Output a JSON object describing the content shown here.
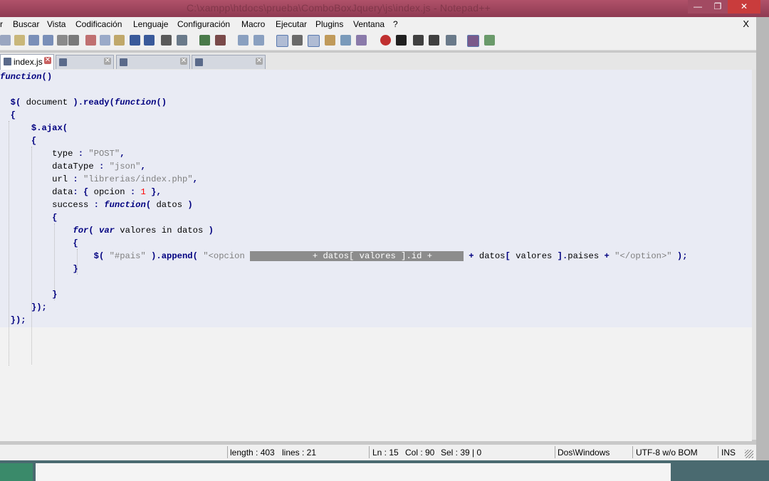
{
  "window": {
    "title": "C:\\xampp\\htdocs\\prueba\\ComboBoxJquery\\js\\index.js - Notepad++",
    "close_glyph": "✕"
  },
  "menu": {
    "items": [
      "r",
      "Buscar",
      "Vista",
      "Codificación",
      "Lenguaje",
      "Configuración",
      "Macro",
      "Ejecutar",
      "Plugins",
      "Ventana",
      "?"
    ],
    "close": "X"
  },
  "tabs": [
    {
      "label": "index.js",
      "active": true
    }
  ],
  "code": {
    "lines": [
      {
        "parts": [
          [
            "kw",
            "function"
          ],
          [
            "op",
            "()"
          ]
        ]
      },
      {
        "parts": []
      },
      {
        "parts": [
          [
            "op",
            "  $( "
          ],
          [
            "t",
            "document"
          ],
          [
            "op",
            " ).ready("
          ],
          [
            "kw",
            "function"
          ],
          [
            "op",
            "()"
          ]
        ]
      },
      {
        "parts": [
          [
            "op",
            "  {"
          ]
        ]
      },
      {
        "parts": [
          [
            "op",
            "      $.ajax("
          ]
        ]
      },
      {
        "parts": [
          [
            "op",
            "      {"
          ]
        ]
      },
      {
        "parts": [
          [
            "t",
            "          type "
          ],
          [
            "op",
            ": "
          ],
          [
            "str",
            "\"POST\""
          ],
          [
            "op",
            ","
          ]
        ]
      },
      {
        "parts": [
          [
            "t",
            "          dataType "
          ],
          [
            "op",
            ": "
          ],
          [
            "str",
            "\"json\""
          ],
          [
            "op",
            ","
          ]
        ]
      },
      {
        "parts": [
          [
            "t",
            "          url "
          ],
          [
            "op",
            ": "
          ],
          [
            "str",
            "\"librerias/index.php\""
          ],
          [
            "op",
            ","
          ]
        ]
      },
      {
        "parts": [
          [
            "t",
            "          data"
          ],
          [
            "op",
            ": { "
          ],
          [
            "t",
            "opcion "
          ],
          [
            "op",
            ": "
          ],
          [
            "num",
            "1"
          ],
          [
            "op",
            " },"
          ]
        ]
      },
      {
        "parts": [
          [
            "t",
            "          success "
          ],
          [
            "op",
            ": "
          ],
          [
            "kw",
            "function"
          ],
          [
            "op",
            "( "
          ],
          [
            "t",
            "datos "
          ],
          [
            "op",
            ")"
          ]
        ]
      },
      {
        "parts": [
          [
            "op",
            "          {"
          ]
        ]
      },
      {
        "parts": [
          [
            "t",
            "              "
          ],
          [
            "kw",
            "for"
          ],
          [
            "op",
            "( "
          ],
          [
            "kw",
            "var"
          ],
          [
            "t",
            " valores in datos "
          ],
          [
            "op",
            ")"
          ]
        ]
      },
      {
        "parts": [
          [
            "op",
            "              {"
          ]
        ]
      },
      {
        "parts": [
          [
            "op",
            "                  $( "
          ],
          [
            "str",
            "\"#pais\""
          ],
          [
            "op",
            " ).append( "
          ],
          [
            "str",
            "\"<opcion "
          ],
          [
            "sel",
            "            + datos[ valores ].id +      "
          ],
          [
            "op",
            " + "
          ],
          [
            "t",
            "datos"
          ],
          [
            "op",
            "[ "
          ],
          [
            "t",
            "valores "
          ],
          [
            "op",
            "]."
          ],
          [
            "t",
            "paises "
          ],
          [
            "op",
            "+ "
          ],
          [
            "str",
            "\"</option>\""
          ],
          [
            "op",
            " );"
          ]
        ]
      },
      {
        "parts": [
          [
            "op",
            "              }"
          ]
        ]
      },
      {
        "parts": []
      },
      {
        "parts": [
          [
            "op",
            "          }"
          ]
        ]
      },
      {
        "parts": [
          [
            "op",
            "      });"
          ]
        ]
      },
      {
        "parts": [
          [
            "op",
            "  });"
          ]
        ]
      }
    ]
  },
  "status": {
    "length": "length : 403",
    "lines": "lines : 21",
    "ln": "Ln : 15",
    "col": "Col : 90",
    "sel": "Sel : 39 | 0",
    "eol": "Dos\\Windows",
    "encoding": "UTF-8 w/o BOM",
    "mode": "INS"
  },
  "colors": {
    "keyword": "#000080",
    "string": "#808080",
    "number": "#ff0000",
    "selection": "#8c8c8c",
    "editor_bg": "#e9ebf4",
    "titlebar": "#a24a62"
  }
}
